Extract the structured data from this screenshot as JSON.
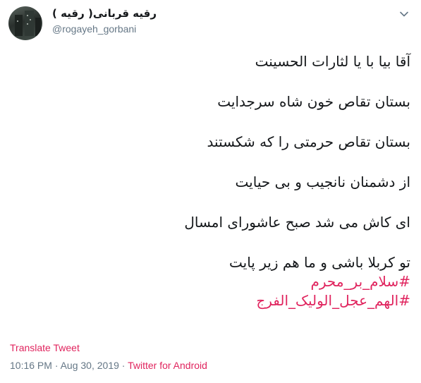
{
  "tweet": {
    "display_name": "رقیه قربانی( رقیه )",
    "handle": "@rogayeh_gorbani",
    "menu_icon": "chevron-down-icon",
    "lines": [
      "آقا بیا با یا لثارات الحسینت",
      "بستان تقاص خون شاه سرجدایت",
      "بستان تقاص حرمتی را که شکستند",
      "از دشمنان نانجیب و بی حیایت",
      "ای کاش می شد صبح عاشورای امسال",
      "تو کربلا باشی و ما هم زیر پایت"
    ],
    "hashtags": [
      "#سلام_بر_محرم",
      "#الهم_عجل_الولیک_الفرج"
    ],
    "translate_label": "Translate Tweet",
    "timestamp": "10:16 PM · Aug 30, 2019",
    "separator": " · ",
    "source": "Twitter for Android",
    "colors": {
      "text": "#14171a",
      "secondary": "#657786",
      "accent": "#e0245e"
    }
  }
}
